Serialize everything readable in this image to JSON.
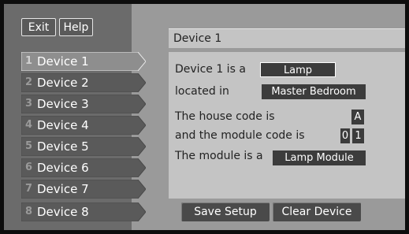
{
  "header": {
    "exit_label": "Exit",
    "help_label": "Help"
  },
  "devices": [
    {
      "num": "1",
      "label": "Device 1",
      "selected": true
    },
    {
      "num": "2",
      "label": "Device 2"
    },
    {
      "num": "3",
      "label": "Device 3"
    },
    {
      "num": "4",
      "label": "Device 4"
    },
    {
      "num": "5",
      "label": "Device 5"
    },
    {
      "num": "6",
      "label": "Device 6"
    },
    {
      "num": "7",
      "label": "Device 7"
    },
    {
      "num": "8",
      "label": "Device 8"
    }
  ],
  "panel": {
    "title": "Device 1",
    "device_is_label": "Device 1 is a",
    "device_type": "Lamp",
    "located_in_label": "located in",
    "location": "Master Bedroom",
    "house_code_label": "The house code is",
    "house_code": "A",
    "module_code_label": "and the module code is",
    "module_code_tens": "0",
    "module_code_ones": "1",
    "module_is_label": "The module is a",
    "module_type": "Lamp Module"
  },
  "actions": {
    "save_label": "Save Setup",
    "clear_label": "Clear Device"
  },
  "colors": {
    "sidebar_bg": "#6b6b6b",
    "item_bg": "#5a5a5a",
    "item_selected_bg": "#8e8e8e",
    "panel_bg": "#c4c4c4",
    "value_bg": "#3c3c3c"
  }
}
